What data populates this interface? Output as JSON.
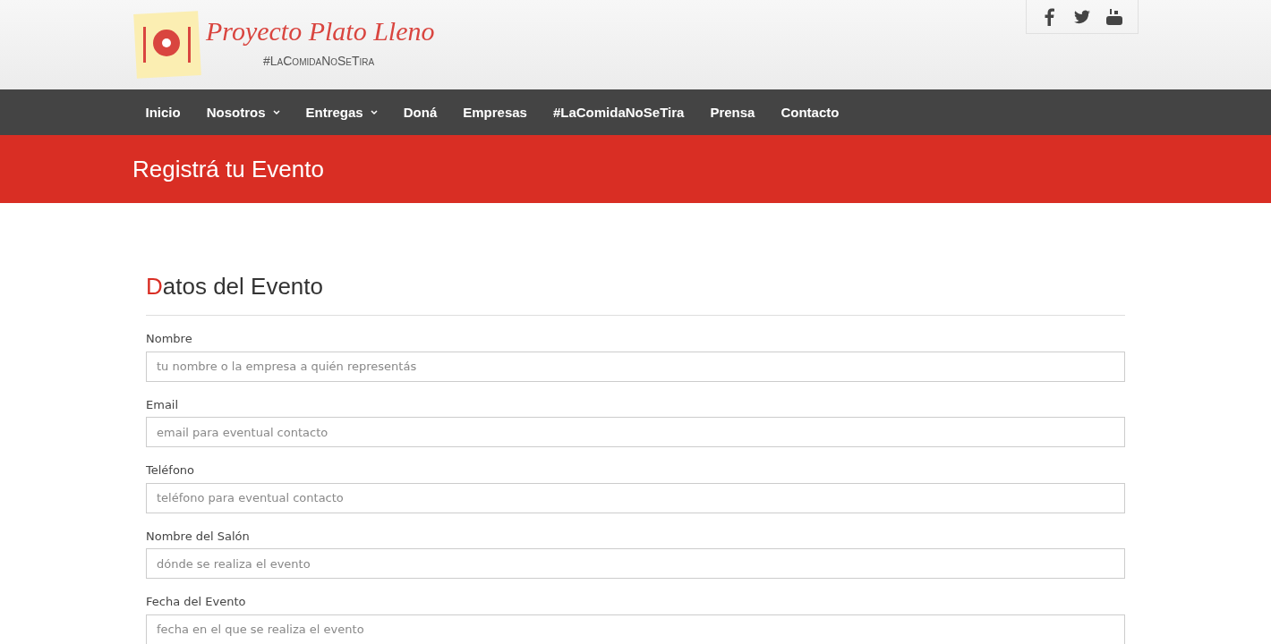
{
  "logo": {
    "title": "Proyecto Plato Lleno",
    "tagline": "#LaComidaNoSeTira"
  },
  "nav": [
    {
      "label": "Inicio",
      "dropdown": false
    },
    {
      "label": "Nosotros",
      "dropdown": true
    },
    {
      "label": "Entregas",
      "dropdown": true
    },
    {
      "label": "Doná",
      "dropdown": false
    },
    {
      "label": "Empresas",
      "dropdown": false
    },
    {
      "label": "#LaComidaNoSeTira",
      "dropdown": false
    },
    {
      "label": "Prensa",
      "dropdown": false
    },
    {
      "label": "Contacto",
      "dropdown": false
    }
  ],
  "banner": {
    "title": "Registrá tu Evento"
  },
  "form": {
    "heading": "Datos del Evento",
    "fields": [
      {
        "label": "Nombre",
        "placeholder": "tu nombre o la empresa a quién representás"
      },
      {
        "label": "Email",
        "placeholder": "email para eventual contacto"
      },
      {
        "label": "Teléfono",
        "placeholder": "teléfono para eventual contacto"
      },
      {
        "label": "Nombre del Salón",
        "placeholder": "dónde se realiza el evento"
      },
      {
        "label": "Fecha del Evento",
        "placeholder": "fecha en el que se realiza el evento"
      }
    ]
  }
}
